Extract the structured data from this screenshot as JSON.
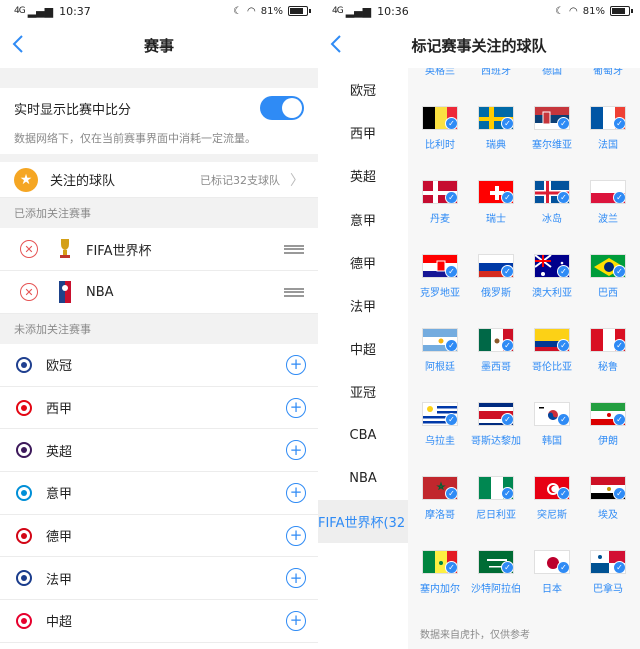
{
  "left": {
    "status": {
      "signal": "4G",
      "time": "10:37",
      "battery": "81%"
    },
    "nav": {
      "title": "赛事"
    },
    "realtime": {
      "label": "实时显示比赛中比分",
      "enabled": true,
      "hint": "数据网络下，仅在当前赛事界面中消耗一定流量。"
    },
    "favorite": {
      "label": "关注的球队",
      "status": "已标记32支球队"
    },
    "added_section": "已添加关注赛事",
    "added": [
      {
        "label": "FIFA世界杯",
        "icon": "world-cup-trophy-icon"
      },
      {
        "label": "NBA",
        "icon": "nba-logo-icon"
      }
    ],
    "unadded_section": "未添加关注赛事",
    "unadded": [
      {
        "label": "欧冠",
        "icon": "champions-league-icon"
      },
      {
        "label": "西甲",
        "icon": "laliga-icon"
      },
      {
        "label": "英超",
        "icon": "premier-league-icon"
      },
      {
        "label": "意甲",
        "icon": "serie-a-icon"
      },
      {
        "label": "德甲",
        "icon": "bundesliga-icon"
      },
      {
        "label": "法甲",
        "icon": "ligue1-icon"
      },
      {
        "label": "中超",
        "icon": "csl-icon"
      }
    ]
  },
  "right": {
    "status": {
      "signal": "4G",
      "time": "10:36",
      "battery": "81%"
    },
    "nav": {
      "title": "标记赛事关注的球队"
    },
    "leagues": [
      "欧冠",
      "西甲",
      "英超",
      "意甲",
      "德甲",
      "法甲",
      "中超",
      "亚冠",
      "CBA",
      "NBA",
      "FIFA世界杯(32"
    ],
    "active_league": 10,
    "teams": [
      {
        "name": "英格兰",
        "flag": "england"
      },
      {
        "name": "西班牙",
        "flag": "spain"
      },
      {
        "name": "德国",
        "flag": "germany"
      },
      {
        "name": "葡萄牙",
        "flag": "portugal"
      },
      {
        "name": "比利时",
        "flag": "belgium"
      },
      {
        "name": "瑞典",
        "flag": "sweden"
      },
      {
        "name": "塞尔维亚",
        "flag": "serbia"
      },
      {
        "name": "法国",
        "flag": "france"
      },
      {
        "name": "丹麦",
        "flag": "denmark"
      },
      {
        "name": "瑞士",
        "flag": "switzerland"
      },
      {
        "name": "冰岛",
        "flag": "iceland"
      },
      {
        "name": "波兰",
        "flag": "poland"
      },
      {
        "name": "克罗地亚",
        "flag": "croatia"
      },
      {
        "name": "俄罗斯",
        "flag": "russia"
      },
      {
        "name": "澳大利亚",
        "flag": "australia"
      },
      {
        "name": "巴西",
        "flag": "brazil"
      },
      {
        "name": "阿根廷",
        "flag": "argentina"
      },
      {
        "name": "墨西哥",
        "flag": "mexico"
      },
      {
        "name": "哥伦比亚",
        "flag": "colombia"
      },
      {
        "name": "秘鲁",
        "flag": "peru"
      },
      {
        "name": "乌拉圭",
        "flag": "uruguay"
      },
      {
        "name": "哥斯达黎加",
        "flag": "costa-rica"
      },
      {
        "name": "韩国",
        "flag": "korea"
      },
      {
        "name": "伊朗",
        "flag": "iran"
      },
      {
        "name": "摩洛哥",
        "flag": "morocco"
      },
      {
        "name": "尼日利亚",
        "flag": "nigeria"
      },
      {
        "name": "突尼斯",
        "flag": "tunisia"
      },
      {
        "name": "埃及",
        "flag": "egypt"
      },
      {
        "name": "塞内加尔",
        "flag": "senegal"
      },
      {
        "name": "沙特阿拉伯",
        "flag": "saudi-arabia"
      },
      {
        "name": "日本",
        "flag": "japan"
      },
      {
        "name": "巴拿马",
        "flag": "panama"
      }
    ],
    "footer": "数据来自虎扑，仅供参考"
  },
  "colors": {
    "accent": "#2f8bf5",
    "remove": "#e55353",
    "star": "#f5a623"
  }
}
